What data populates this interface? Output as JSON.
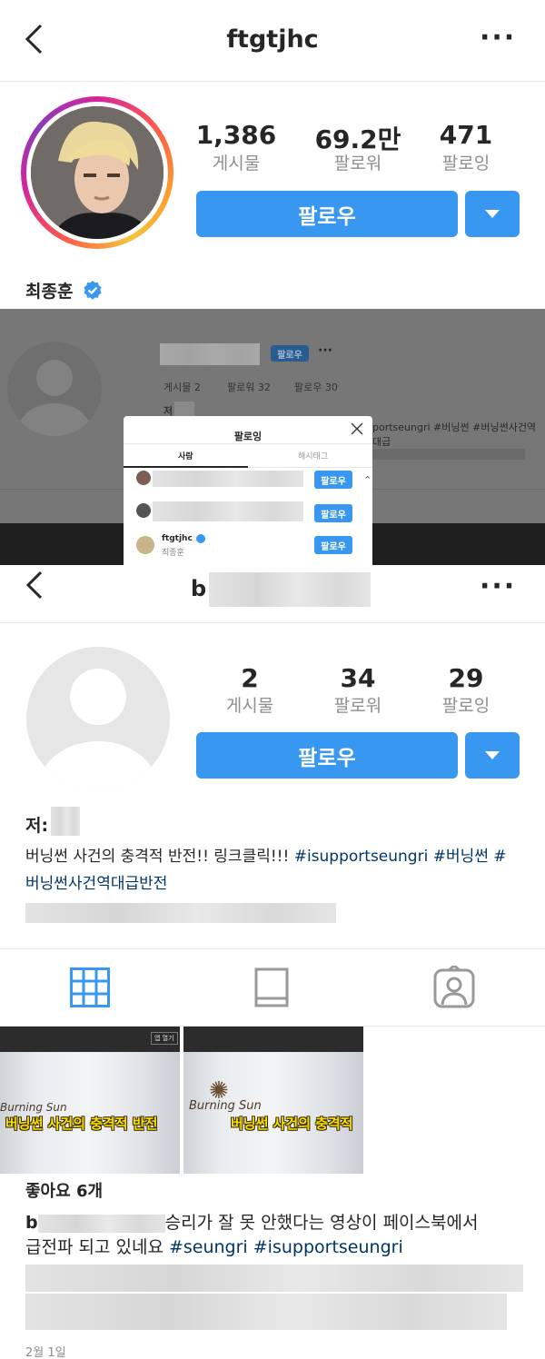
{
  "profile1": {
    "username": "ftgtjhc",
    "display_name": "최종훈",
    "stats": [
      {
        "value": "1,386",
        "label": "게시물"
      },
      {
        "value": "69.2만",
        "label": "팔로워"
      },
      {
        "value": "471",
        "label": "팔로잉"
      }
    ],
    "follow_label": "팔로우",
    "verified": true
  },
  "embedded_screenshot": {
    "follow_label": "팔로우",
    "more": "···",
    "stats": [
      "게시물 2",
      "팔로워 32",
      "팔로우 30"
    ],
    "bio_prefix": "저",
    "bio_tags": "portseungri #버닝썬 #버닝썬사건역대급",
    "modal": {
      "title": "팔로잉",
      "tab_people": "사람",
      "tab_hashtag": "해시태그",
      "rows": [
        {
          "follow": "팔로우"
        },
        {
          "follow": "팔로우"
        },
        {
          "username": "ftgtjhc",
          "name": "최종훈",
          "follow": "팔로우"
        }
      ]
    }
  },
  "profile2": {
    "username_prefix": "b",
    "stats": [
      {
        "value": "2",
        "label": "게시물"
      },
      {
        "value": "34",
        "label": "팔로워"
      },
      {
        "value": "29",
        "label": "팔로잉"
      }
    ],
    "follow_label": "팔로우",
    "name_prefix": "저:",
    "bio_text": "버닝썬 사건의 충격적 반전!! 링크클릭!!! ",
    "bio_tags_1": "#isupportseungri #버닝썬 #",
    "bio_tags_2": "버닝썬사건역대급반전"
  },
  "posts": {
    "thumb_badges": [
      "앱 열기"
    ],
    "thumb_caption_1": "버닝썬 사건의 충격적 반전",
    "thumb_caption_2": "버닝썬 사건의 충격적",
    "sign_text": "Burning Sun"
  },
  "post": {
    "likes": "좋아요 6개",
    "author_prefix": "b",
    "text_1": "승리가 잘 못 안했다는 영상이 페이스북에서",
    "text_2": "급전파 되고 있네요 ",
    "tags": "#seungri #isupportseungri",
    "date": "2월 1일"
  },
  "icons": [
    "back-icon",
    "more-icon",
    "verified-icon",
    "grid-icon",
    "feed-icon",
    "tagged-icon",
    "close-icon"
  ],
  "colors": {
    "accent": "#3897f0",
    "hashtag": "#003569",
    "muted": "#8e8e8e"
  }
}
